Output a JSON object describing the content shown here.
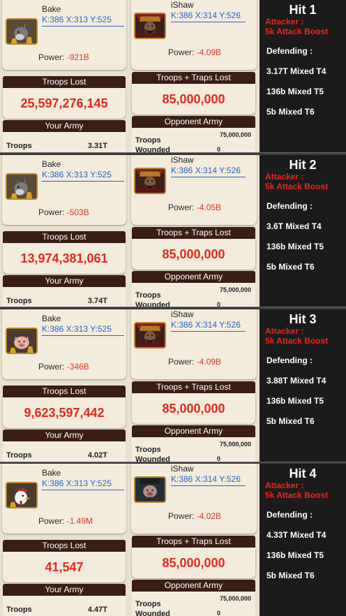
{
  "colors": {
    "page_background": "#e9e1cf",
    "card_background": "#f3ecdc",
    "header_background": "#3a1d14",
    "stat_red": "#e02a20",
    "coords_blue": "#2a63c7",
    "side_background": "#1b1b1b",
    "attacker_red": "#e8261c"
  },
  "panels": [
    {
      "attacker": {
        "name": "Bake",
        "coords": "K:386 X:313 Y:525",
        "power_label": "Power:",
        "power_value": "-921B",
        "avatar": "donkey-avatar"
      },
      "defender": {
        "name": "iShaw",
        "coords": "K:386 X:314 Y:526",
        "power_label": "Power:",
        "power_value": "-4.09B",
        "avatar": "warrior-avatar"
      },
      "troops_lost": {
        "label": "Troops Lost",
        "value": "25,597,276,145"
      },
      "troops_traps_lost": {
        "label": "Troops + Traps Lost",
        "value": "85,000,000"
      },
      "your_army": {
        "label": "Your Army",
        "troops_label": "Troops",
        "troops_value": "3.31T"
      },
      "opponent_army": {
        "label": "Opponent Army",
        "troops_label": "Troops",
        "troops_value": "75,000,000",
        "wounded_label": "Wounded",
        "wounded_value": "0"
      },
      "side": {
        "title": "Hit 1",
        "attacker_line1": "Attacker :",
        "attacker_line2": "5k Attack Boost",
        "defending": "Defending :",
        "line1": "3.17T Mixed T4",
        "line2": "136b Mixed T5",
        "line3": "5b Mixed T6"
      }
    },
    {
      "attacker": {
        "name": "Bake",
        "coords": "K:386 X:313 Y:525",
        "power_label": "Power:",
        "power_value": "-503B",
        "avatar": "donkey-avatar"
      },
      "defender": {
        "name": "iShaw",
        "coords": "K:386 X:314 Y:526",
        "power_label": "Power:",
        "power_value": "-4.05B",
        "avatar": "warrior-avatar"
      },
      "troops_lost": {
        "label": "Troops Lost",
        "value": "13,974,381,061"
      },
      "troops_traps_lost": {
        "label": "Troops + Traps Lost",
        "value": "85,000,000"
      },
      "your_army": {
        "label": "Your Army",
        "troops_label": "Troops",
        "troops_value": "3.74T"
      },
      "opponent_army": {
        "label": "Opponent Army",
        "troops_label": "Troops",
        "troops_value": "75,000,000",
        "wounded_label": "Wounded",
        "wounded_value": "0"
      },
      "side": {
        "title": "Hit 2",
        "attacker_line1": "Attacker :",
        "attacker_line2": "5k Attack Boost",
        "defending": "Defending :",
        "line1": "3.6T Mixed T4",
        "line2": "136b Mixed T5",
        "line3": "5b Mixed T6"
      }
    },
    {
      "attacker": {
        "name": "Bake",
        "coords": "K:386 X:313 Y:525",
        "power_label": "Power:",
        "power_value": "-346B",
        "avatar": "pig-avatar"
      },
      "defender": {
        "name": "iShaw",
        "coords": "K:386 X:314 Y:526",
        "power_label": "Power:",
        "power_value": "-4.09B",
        "avatar": "warrior-avatar"
      },
      "troops_lost": {
        "label": "Troops Lost",
        "value": "9,623,597,442"
      },
      "troops_traps_lost": {
        "label": "Troops + Traps Lost",
        "value": "85,000,000"
      },
      "your_army": {
        "label": "Your Army",
        "troops_label": "Troops",
        "troops_value": "4.02T"
      },
      "opponent_army": {
        "label": "Opponent Army",
        "troops_label": "Troops",
        "troops_value": "75,000,000",
        "wounded_label": "Wounded",
        "wounded_value": "0"
      },
      "side": {
        "title": "Hit 3",
        "attacker_line1": "Attacker :",
        "attacker_line2": "5k Attack Boost",
        "defending": "Defending :",
        "line1": "3.88T Mixed T4",
        "line2": "136b Mixed T5",
        "line3": "5b Mixed T6"
      }
    },
    {
      "attacker": {
        "name": "Bake",
        "coords": "K:386 X:313 Y:525",
        "power_label": "Power:",
        "power_value": "-1.49M",
        "avatar": "chicken-avatar"
      },
      "defender": {
        "name": "iShaw",
        "coords": "K:386 X:314 Y:526",
        "power_label": "Power:",
        "power_value": "-4.02B",
        "avatar": "pig-warrior-avatar"
      },
      "troops_lost": {
        "label": "Troops Lost",
        "value": "41,547"
      },
      "troops_traps_lost": {
        "label": "Troops + Traps Lost",
        "value": "85,000,000"
      },
      "your_army": {
        "label": "Your Army",
        "troops_label": "Troops",
        "troops_value": "4.47T"
      },
      "opponent_army": {
        "label": "Opponent Army",
        "troops_label": "Troops",
        "troops_value": "75,000,000",
        "wounded_label": "Wounded",
        "wounded_value": "0"
      },
      "side": {
        "title": "Hit 4",
        "attacker_line1": "Attacker :",
        "attacker_line2": "5k Attack Boost",
        "defending": "Defending :",
        "line1": "4.33T Mixed T4",
        "line2": "136b Mixed T5",
        "line3": "5b Mixed T6"
      }
    }
  ]
}
